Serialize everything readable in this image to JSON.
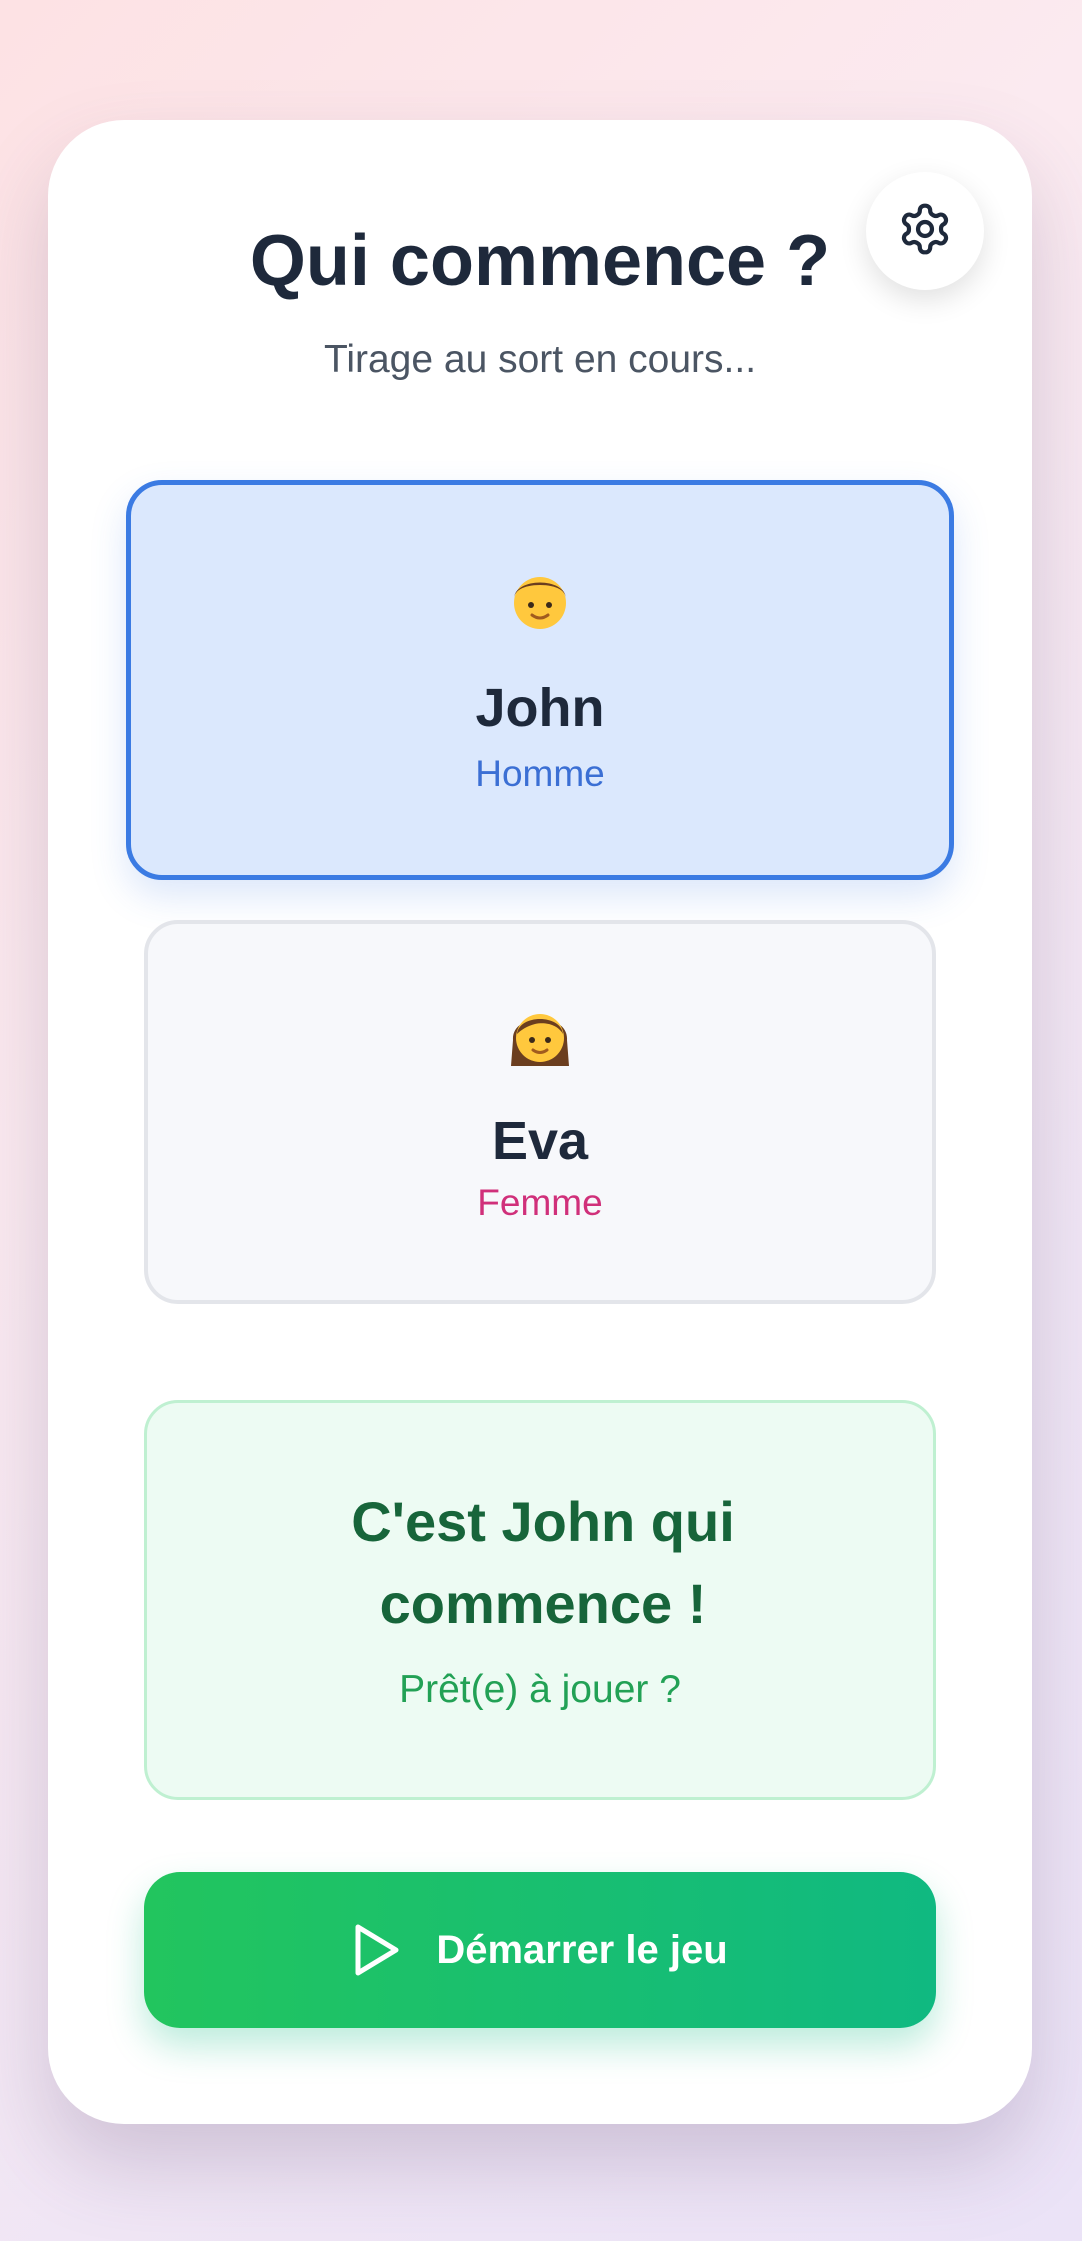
{
  "header": {
    "title": "Qui commence ?",
    "subtitle": "Tirage au sort en cours..."
  },
  "settings": {
    "icon": "gear-icon"
  },
  "players": [
    {
      "name": "John",
      "gender": "Homme",
      "avatar": "man-emoji",
      "selected": true,
      "gender_color": "#3b6fd4"
    },
    {
      "name": "Eva",
      "gender": "Femme",
      "avatar": "woman-emoji",
      "selected": false,
      "gender_color": "#d0307a"
    }
  ],
  "result": {
    "message": "C'est John qui commence !",
    "prompt": "Prêt(e) à jouer ?"
  },
  "start_button": {
    "label": "Démarrer le jeu",
    "icon": "play-icon"
  },
  "colors": {
    "accent_blue": "#3b7be3",
    "success_green": "#22c55e",
    "title_text": "#1e293b"
  }
}
